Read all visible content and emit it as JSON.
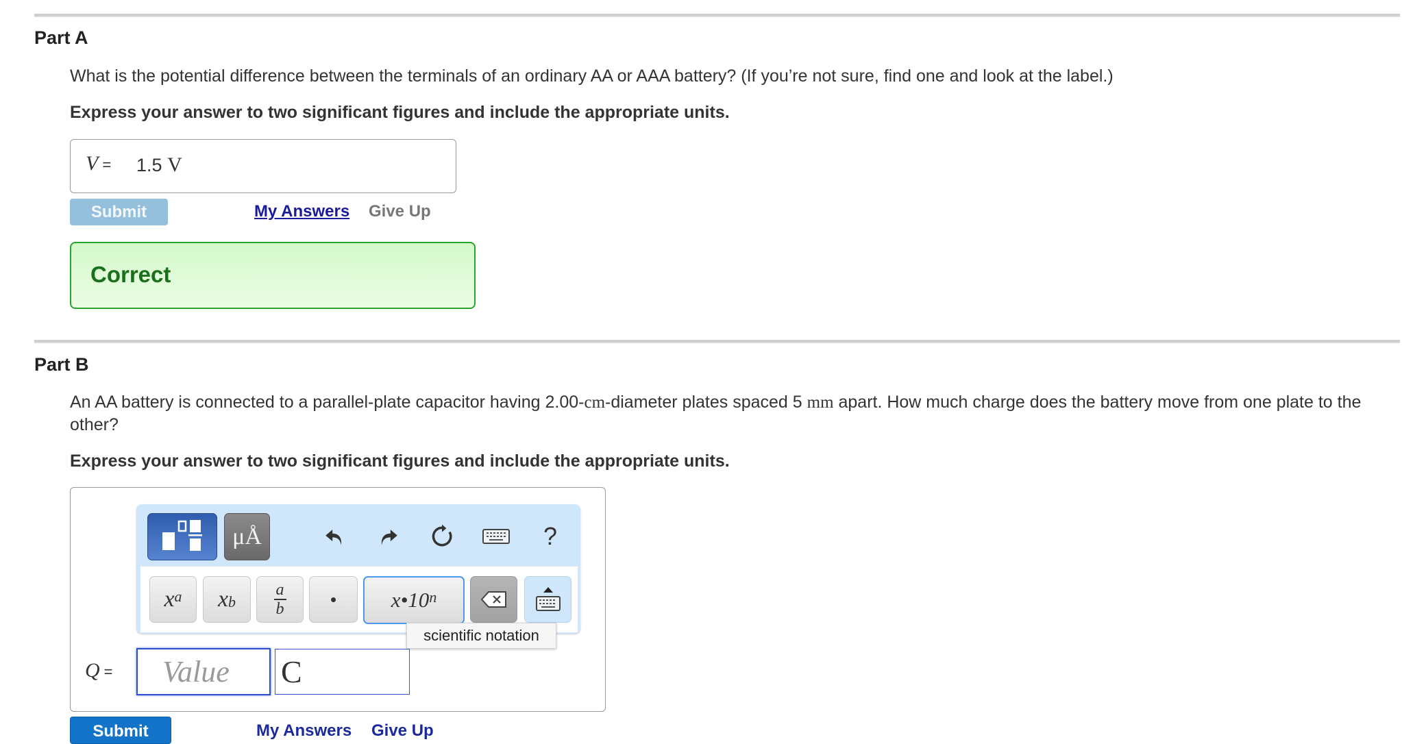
{
  "part_a": {
    "title": "Part A",
    "question": "What is the potential difference between the terminals of an ordinary AA or AAA battery? (If you’re not sure, find one and look at the label.)",
    "instruction": "Express your answer to two significant figures and include the appropriate units.",
    "answer": {
      "variable": "V",
      "equals": "=",
      "value": "1.5",
      "unit": "V"
    },
    "submit_label": "Submit",
    "my_answers_label": "My Answers",
    "give_up_label": "Give Up",
    "feedback": "Correct"
  },
  "part_b": {
    "title": "Part B",
    "question": {
      "seg1": "An AA battery is connected to a parallel-plate capacitor having 2.00-",
      "unit1": "cm",
      "seg2": "-diameter plates spaced 5 ",
      "unit2": "mm",
      "seg3": " apart. How much charge does the battery move from one plate to the other?"
    },
    "instruction": "Express your answer to two significant figures and include the appropriate units.",
    "toolbar": {
      "templates_icon": "templates-icon",
      "units_label": "μÅ",
      "undo_icon": "undo-icon",
      "redo_icon": "redo-icon",
      "reset_icon": "reset-icon",
      "keyboard_icon": "keyboard-icon",
      "help_label": "?"
    },
    "keypad": {
      "superscript": {
        "base": "x",
        "exp": "a"
      },
      "subscript": {
        "base": "x",
        "sub": "b"
      },
      "fraction": {
        "num": "a",
        "den": "b"
      },
      "dot": "•",
      "scientific": {
        "base": "x•10",
        "exp": "n"
      },
      "backspace_icon": "backspace-icon",
      "keyboard_toggle_icon": "keyboard-toggle-icon"
    },
    "tooltip": "scientific notation",
    "answer": {
      "variable": "Q",
      "equals": "=",
      "value": "",
      "value_placeholder": "Value",
      "unit": "C"
    },
    "submit_label": "Submit",
    "my_answers_label": "My Answers",
    "give_up_label": "Give Up"
  },
  "colors": {
    "submit_active": "#1373c8",
    "submit_disabled": "#94bfdd",
    "correct_border": "#2aa32a",
    "correct_text": "#1a701a",
    "toolbar_bg": "#cfe6fb",
    "link": "#1a1a9c"
  }
}
